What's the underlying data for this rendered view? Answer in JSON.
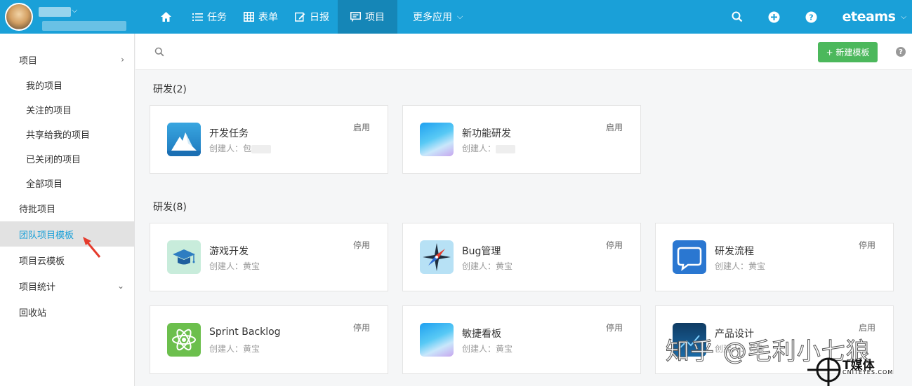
{
  "topbar": {
    "nav": [
      {
        "id": "home",
        "label": ""
      },
      {
        "id": "tasks",
        "label": "任务"
      },
      {
        "id": "forms",
        "label": "表单"
      },
      {
        "id": "daily",
        "label": "日报"
      },
      {
        "id": "projects",
        "label": "项目"
      },
      {
        "id": "more",
        "label": "更多应用"
      }
    ],
    "brand": "eteams",
    "accent": "#1aa0d8",
    "active_bg": "#1586b7"
  },
  "sidebar": {
    "items": [
      {
        "label": "项目"
      },
      {
        "label": "我的项目"
      },
      {
        "label": "关注的项目"
      },
      {
        "label": "共享给我的项目"
      },
      {
        "label": "已关闭的项目"
      },
      {
        "label": "全部项目"
      },
      {
        "label": "待批项目"
      },
      {
        "label": "团队项目模板"
      },
      {
        "label": "项目云模板"
      },
      {
        "label": "项目统计"
      },
      {
        "label": "回收站"
      }
    ]
  },
  "toolbar": {
    "search_placeholder": "",
    "new_template_label": "+ 新建模板",
    "help": "?"
  },
  "groups": [
    {
      "title": "研发(2)",
      "cards": [
        {
          "name": "开发任务",
          "creator_label": "创建人：",
          "creator": "包",
          "status": "启用",
          "icon": "iceberg-icon"
        },
        {
          "name": "新功能研发",
          "creator_label": "创建人：",
          "creator": "",
          "status": "启用",
          "icon": "gradient-icon"
        }
      ]
    },
    {
      "title": "研发(8)",
      "cards": [
        {
          "name": "游戏开发",
          "creator_label": "创建人：",
          "creator": "黄宝",
          "status": "停用",
          "icon": "graduation-cap-icon"
        },
        {
          "name": "Bug管理",
          "creator_label": "创建人：",
          "creator": "黄宝",
          "status": "停用",
          "icon": "compass-icon"
        },
        {
          "name": "研发流程",
          "creator_label": "创建人：",
          "creator": "黄宝",
          "status": "停用",
          "icon": "chat-bubble-icon"
        },
        {
          "name": "Sprint Backlog",
          "creator_label": "创建人：",
          "creator": "黄宝",
          "status": "停用",
          "icon": "atom-icon"
        },
        {
          "name": "敏捷看板",
          "creator_label": "创建人：",
          "creator": "黄宝",
          "status": "停用",
          "icon": "gradient-icon"
        },
        {
          "name": "产品设计",
          "creator_label": "创建人：",
          "creator": "黄宝",
          "status": "启用",
          "icon": "product-icon"
        }
      ]
    }
  ],
  "watermark": {
    "text": "知乎 @毛利小七狼",
    "logo_text": "T媒体",
    "logo_sub": "CNITEYES.COM"
  }
}
